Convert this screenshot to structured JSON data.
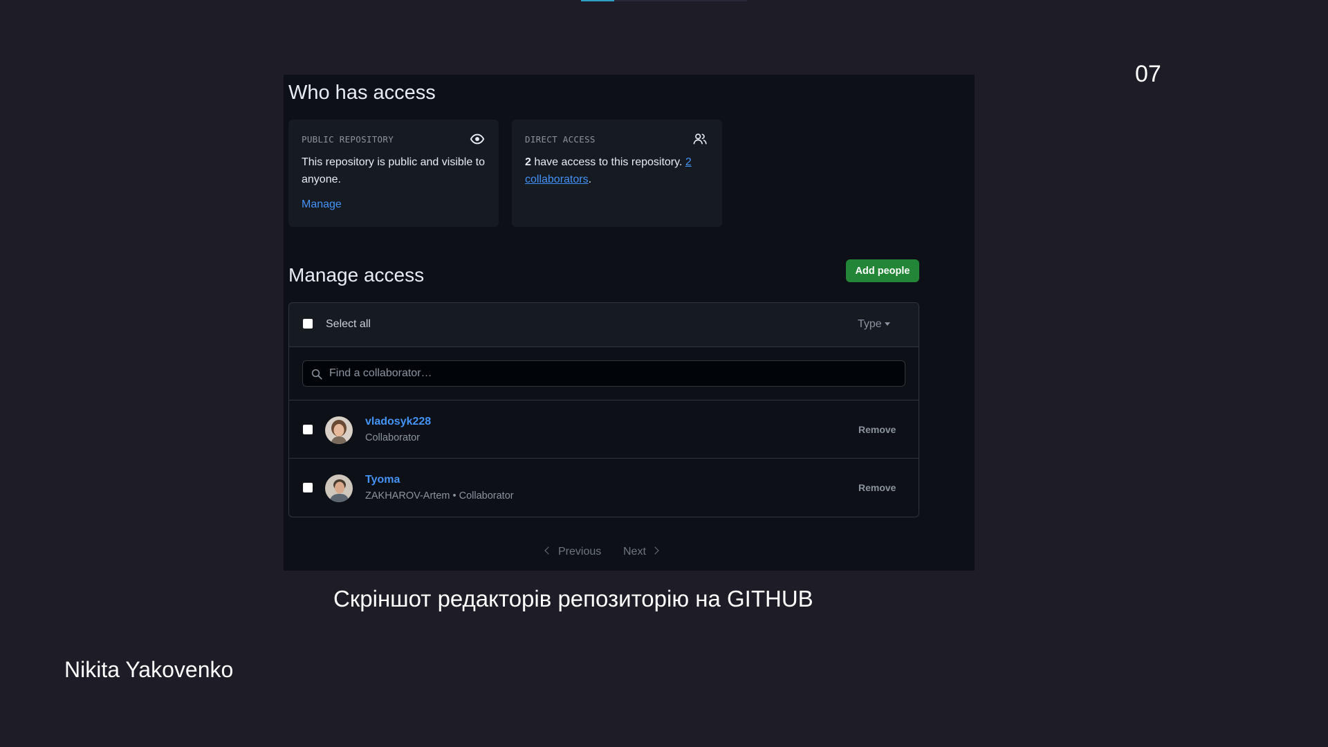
{
  "slide": {
    "number": "07",
    "progress_fraction": 0.2,
    "caption": "Скріншот редакторів репозиторію на GITHUB",
    "author": "Nikita Yakovenko"
  },
  "who_has_access": {
    "title": "Who has access",
    "public_card": {
      "label": "PUBLIC REPOSITORY",
      "icon": "eye-icon",
      "text": "This repository is public and visible to anyone.",
      "link": "Manage"
    },
    "direct_card": {
      "label": "DIRECT ACCESS",
      "icon": "people-icon",
      "count": "2",
      "text_middle": " have access to this repository. ",
      "link": "2 collaborators",
      "text_end": "."
    }
  },
  "manage_access": {
    "title": "Manage access",
    "add_button": "Add people",
    "select_all": "Select all",
    "type_filter": "Type",
    "search_placeholder": "Find a collaborator…",
    "collaborators": [
      {
        "name": "vladosyk228",
        "role": "Collaborator",
        "action": "Remove"
      },
      {
        "name": "Tyoma",
        "role": "ZAKHAROV-Artem • Collaborator",
        "action": "Remove"
      }
    ],
    "pagination": {
      "previous": "Previous",
      "next": "Next"
    }
  },
  "colors": {
    "slide_bg": "#1e1c27",
    "panel_bg": "#0d1117",
    "card_bg": "#161b22",
    "link": "#4493f8",
    "button_green": "#238636",
    "progress_accent": "#2ea0c6"
  }
}
